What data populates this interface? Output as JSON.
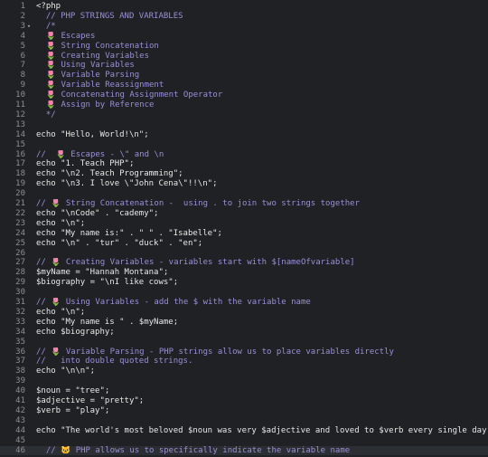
{
  "editor": {
    "lines": [
      {
        "n": "1",
        "code": "<?php",
        "fold": false
      },
      {
        "n": "2",
        "code": "  // PHP STRINGS AND VARIABLES",
        "fold": false
      },
      {
        "n": "3",
        "code": "  /*",
        "fold": true
      },
      {
        "n": "4",
        "code": "  🌷 Escapes",
        "fold": false
      },
      {
        "n": "5",
        "code": "  🌷 String Concatenation",
        "fold": false
      },
      {
        "n": "6",
        "code": "  🌷 Creating Variables",
        "fold": false
      },
      {
        "n": "7",
        "code": "  🌷 Using Variables",
        "fold": false
      },
      {
        "n": "8",
        "code": "  🌷 Variable Parsing",
        "fold": false
      },
      {
        "n": "9",
        "code": "  🌷 Variable Reassignment",
        "fold": false
      },
      {
        "n": "10",
        "code": "  🌷 Concatenating Assignment Operator",
        "fold": false
      },
      {
        "n": "11",
        "code": "  🌷 Assign by Reference",
        "fold": false
      },
      {
        "n": "12",
        "code": "  */",
        "fold": false
      },
      {
        "n": "13",
        "code": "",
        "fold": false
      },
      {
        "n": "14",
        "code": "echo \"Hello, World!\\n\";",
        "fold": false
      },
      {
        "n": "15",
        "code": "",
        "fold": false
      },
      {
        "n": "16",
        "code": "//  🌷 Escapes - \\\" and \\n",
        "fold": false
      },
      {
        "n": "17",
        "code": "echo \"1. Teach PHP\";",
        "fold": false
      },
      {
        "n": "18",
        "code": "echo \"\\n2. Teach Programming\";",
        "fold": false
      },
      {
        "n": "19",
        "code": "echo \"\\n3. I love \\\"John Cena\\\"!!\\n\";",
        "fold": false
      },
      {
        "n": "20",
        "code": "",
        "fold": false
      },
      {
        "n": "21",
        "code": "// 🌷 String Concatenation -  using . to join two strings together",
        "fold": false
      },
      {
        "n": "22",
        "code": "echo \"\\nCode\" . \"cademy\";",
        "fold": false
      },
      {
        "n": "23",
        "code": "echo \"\\n\";",
        "fold": false
      },
      {
        "n": "24",
        "code": "echo \"My name is:\" . \" \" . \"Isabelle\";",
        "fold": false
      },
      {
        "n": "25",
        "code": "echo \"\\n\" . \"tur\" . \"duck\" . \"en\";",
        "fold": false
      },
      {
        "n": "26",
        "code": "",
        "fold": false
      },
      {
        "n": "27",
        "code": "// 🌷 Creating Variables - variables start with $[nameOfvariable]",
        "fold": false
      },
      {
        "n": "28",
        "code": "$myName = \"Hannah Montana\";",
        "fold": false
      },
      {
        "n": "29",
        "code": "$biography = \"\\nI like cows\";",
        "fold": false
      },
      {
        "n": "30",
        "code": "",
        "fold": false
      },
      {
        "n": "31",
        "code": "// 🌷 Using Variables - add the $ with the variable name",
        "fold": false
      },
      {
        "n": "32",
        "code": "echo \"\\n\";",
        "fold": false
      },
      {
        "n": "33",
        "code": "echo \"My name is \" . $myName;",
        "fold": false
      },
      {
        "n": "34",
        "code": "echo $biography;",
        "fold": false
      },
      {
        "n": "35",
        "code": "",
        "fold": false
      },
      {
        "n": "36",
        "code": "// 🌷 Variable Parsing - PHP strings allow us to place variables directly",
        "fold": false
      },
      {
        "n": "37",
        "code": "//   into double quoted strings.",
        "fold": false
      },
      {
        "n": "38",
        "code": "echo \"\\n\\n\";",
        "fold": false
      },
      {
        "n": "39",
        "code": "",
        "fold": false
      },
      {
        "n": "40",
        "code": "$noun = \"tree\";",
        "fold": false
      },
      {
        "n": "41",
        "code": "$adjective = \"pretty\";",
        "fold": false
      },
      {
        "n": "42",
        "code": "$verb = \"play\";",
        "fold": false
      },
      {
        "n": "43",
        "code": "",
        "fold": false
      },
      {
        "n": "44",
        "code": "echo \"The world's most beloved $noun was very $adjective and loved to $verb every single day.\";",
        "fold": false
      },
      {
        "n": "45",
        "code": "",
        "fold": false
      },
      {
        "n": "46",
        "code": "  // 🐱 PHP allows us to specifically indicate the variable name",
        "fold": false
      }
    ],
    "colors": {
      "background": "#1f2124",
      "gutter_text": "#8b8f95",
      "comment": "#9a8fd9",
      "code": "#f0f0f0",
      "tulip_petal": "#e8589a",
      "tulip_stem": "#3fae49"
    },
    "icons": {
      "fold": "chevron-down-icon",
      "tulip": "tulip-emoji-icon",
      "cat": "cat-emoji-icon"
    }
  }
}
